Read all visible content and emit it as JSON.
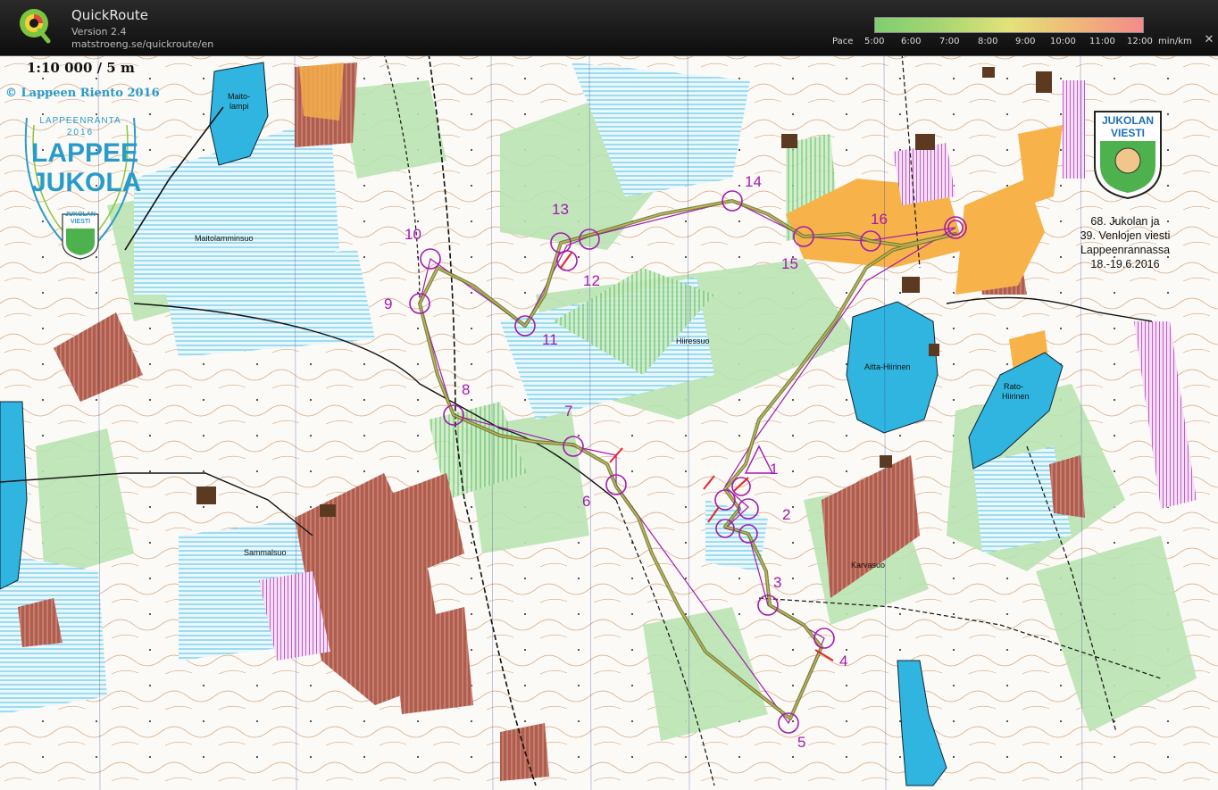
{
  "app": {
    "title": "QuickRoute",
    "version": "Version 2.4",
    "url": "matstroeng.se/quickroute/en"
  },
  "pace_legend": {
    "label": "Pace",
    "ticks": [
      "5:00",
      "6:00",
      "7:00",
      "8:00",
      "9:00",
      "10:00",
      "11:00",
      "12:00"
    ],
    "unit": "min/km"
  },
  "map_header": {
    "scale": "1:10 000 / 5 m",
    "copyright": "© Lappeen Riento 2016",
    "event_logo": {
      "top": "LAPPEENRANTA",
      "year": "2016",
      "line1": "LAPPEE",
      "line2": "JUKOLA"
    },
    "badge_logo": {
      "line1": "JUKOLAN",
      "line2": "VIESTI"
    }
  },
  "event_text": [
    "68. Jukolan ja",
    "39. Venlojen viesti",
    "Lappeenrannassa",
    "18.-19.6.2016"
  ],
  "places": {
    "maitolampi_1": "Maito-",
    "maitolampi_2": "lampi",
    "maitolamminsuo": "Maitolamminsuo",
    "hiiressuo": "Hiiressuo",
    "aitta_hiirinen": "Aitta-Hiirinen",
    "rato_1": "Rato-",
    "rato_2": "Hiirinen",
    "sammalsuo": "Sammalsuo",
    "karvasuo": "Karvasuo"
  },
  "controls": [
    "1",
    "2",
    "3",
    "4",
    "5",
    "6",
    "7",
    "8",
    "9",
    "10",
    "11",
    "12",
    "13",
    "14",
    "15",
    "16"
  ],
  "colors": {
    "course": "#a21ab0",
    "water": "#2fb5e0",
    "route": "#7a8a3a",
    "private": "#a8584a",
    "open": "#f7b24a"
  }
}
